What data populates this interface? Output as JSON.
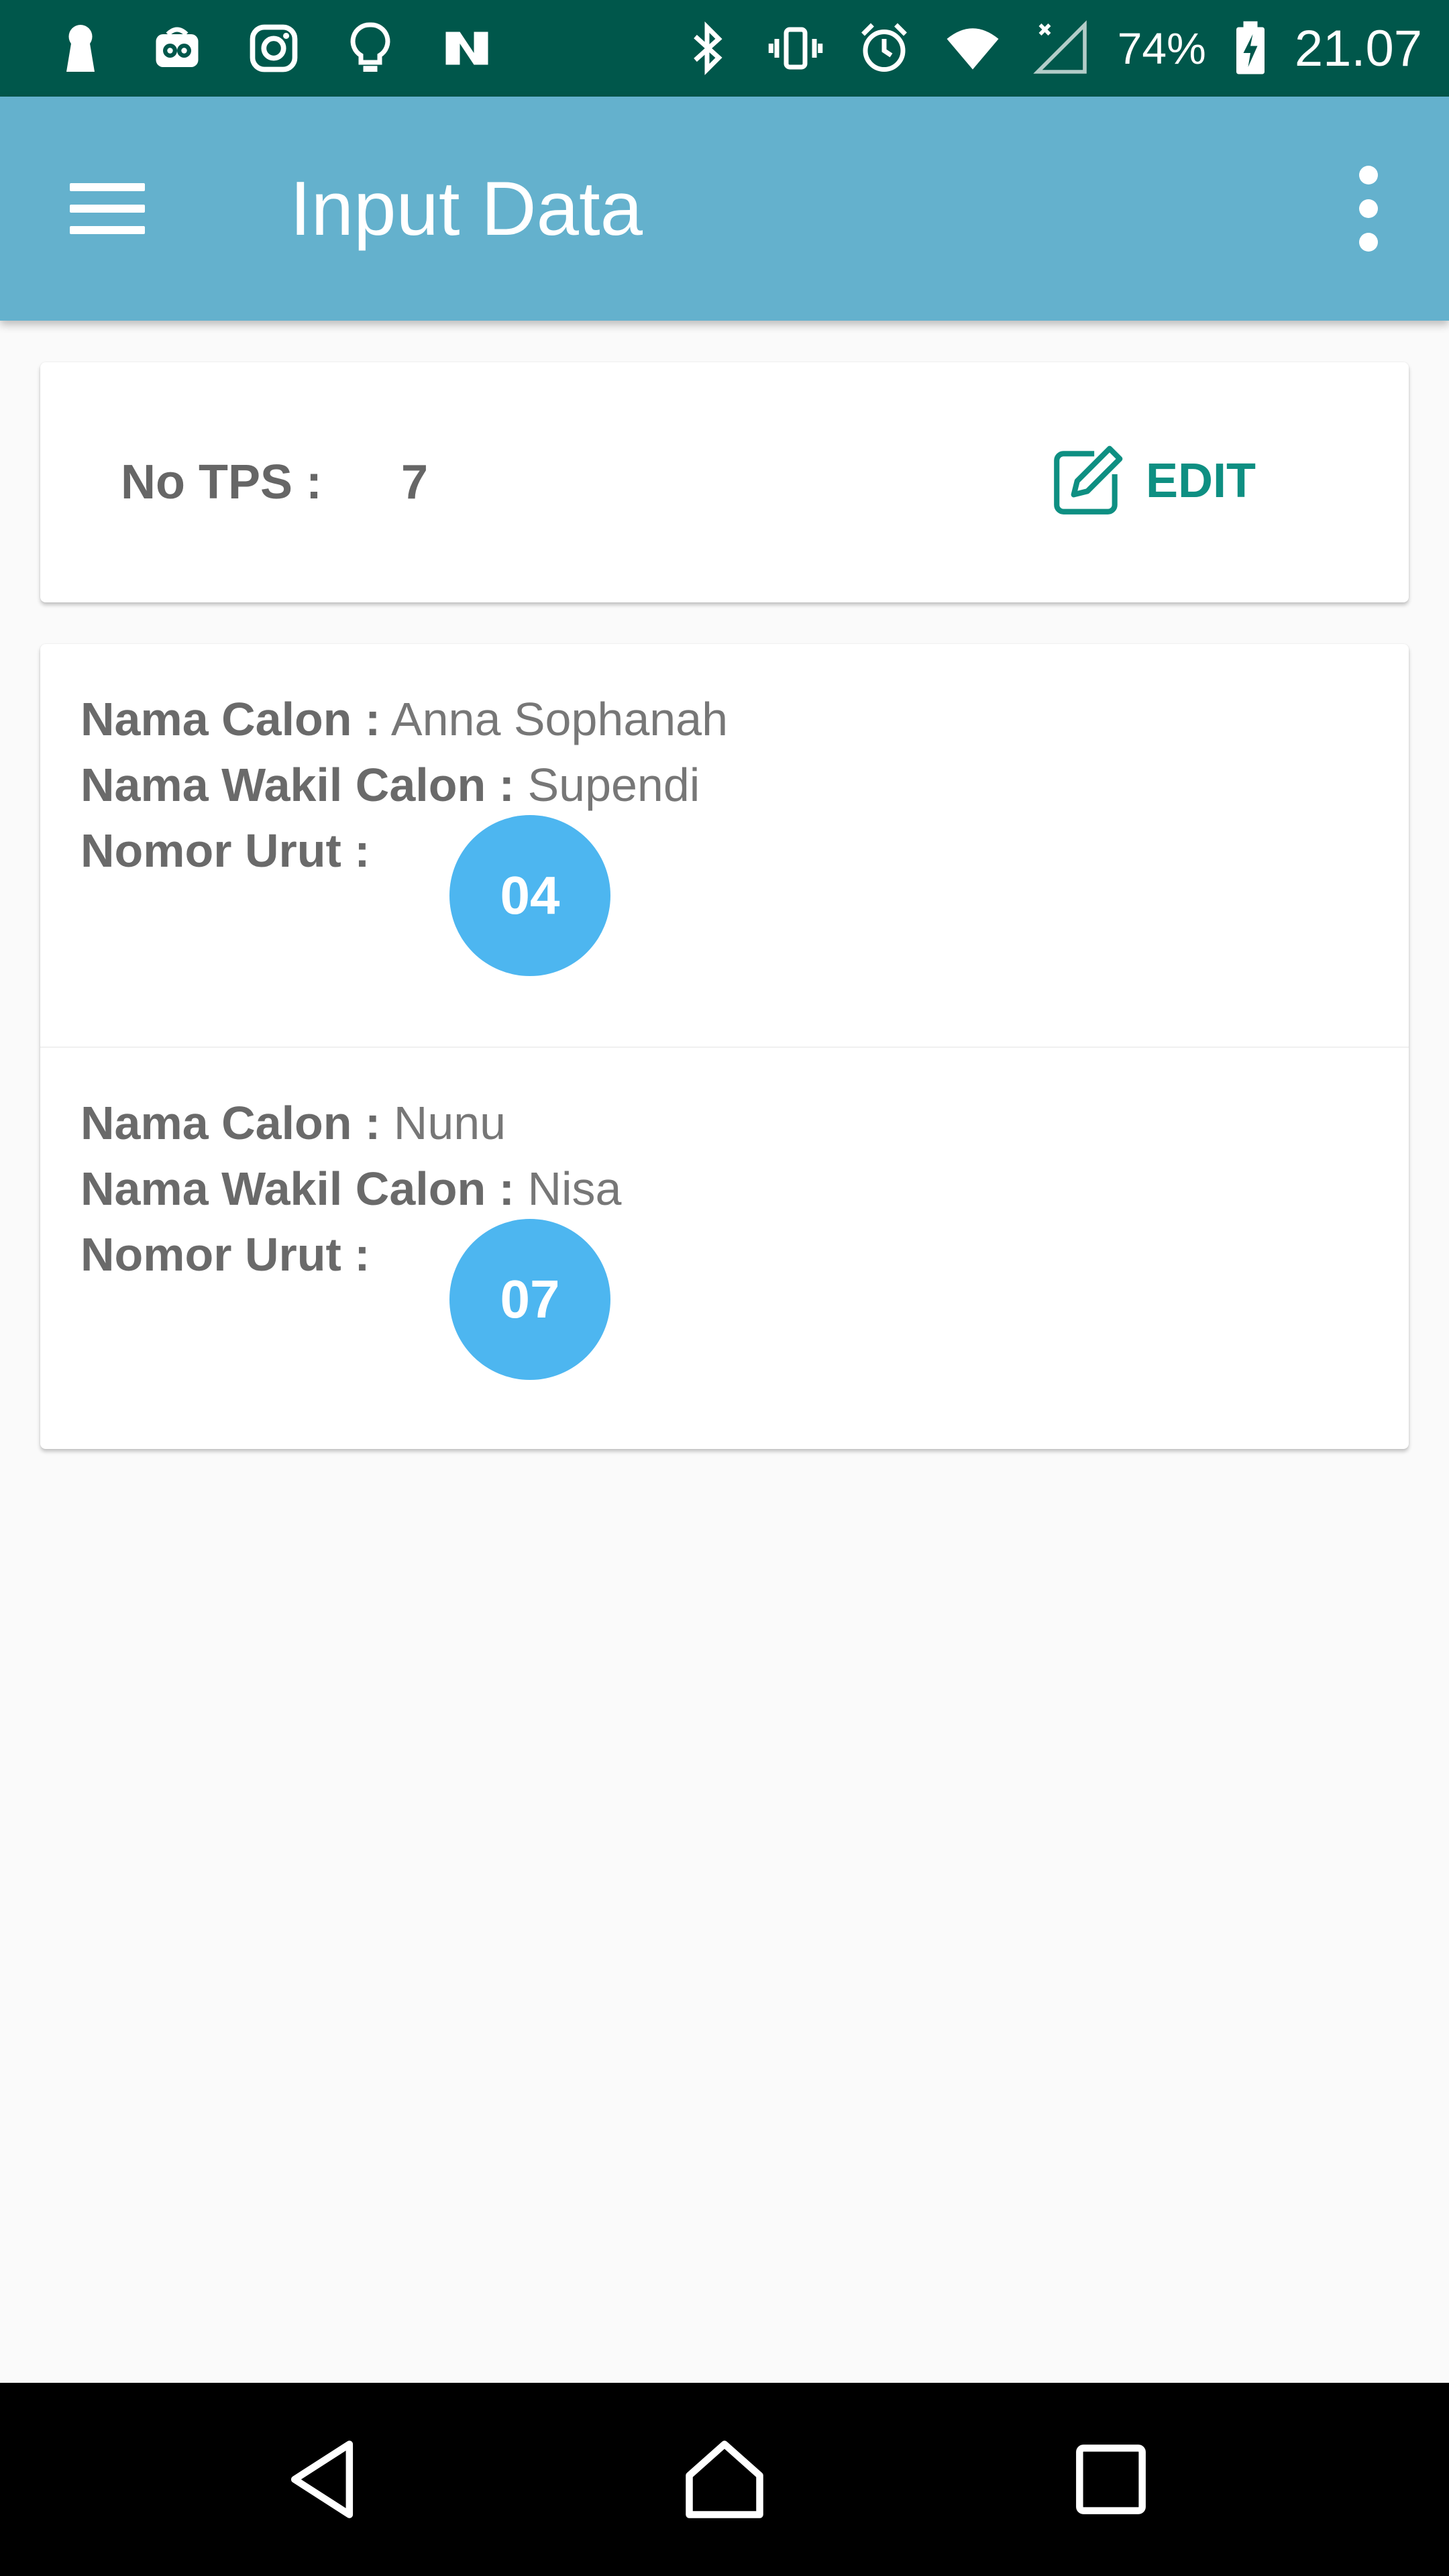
{
  "status_bar": {
    "left_icons": [
      "keyhole-icon",
      "tripadvisor-icon",
      "instagram-icon",
      "lightbulb-icon",
      "n-app-icon"
    ],
    "right_icons": [
      "bluetooth-icon",
      "vibrate-icon",
      "alarm-icon",
      "wifi-icon",
      "signal-icon",
      "battery-icon"
    ],
    "battery": "74%",
    "time": "21.07"
  },
  "app_bar": {
    "title": "Input Data",
    "color": "#64b1cd"
  },
  "tps_card": {
    "label": "No TPS :",
    "value": "7",
    "edit_label": "EDIT",
    "accent": "#0e8f82"
  },
  "candidates": [
    {
      "nama_calon_label": "Nama Calon :",
      "nama_calon": "Anna Sophanah",
      "nama_wakil_label": "Nama Wakil Calon :",
      "nama_wakil": "Supendi",
      "nomor_urut_label": "Nomor Urut :",
      "nomor_urut": "04"
    },
    {
      "nama_calon_label": "Nama Calon :",
      "nama_calon": "Nunu",
      "nama_wakil_label": "Nama Wakil Calon :",
      "nama_wakil": "Nisa",
      "nomor_urut_label": "Nomor Urut :",
      "nomor_urut": "07"
    }
  ],
  "nav_bar": {
    "buttons": [
      "back-icon",
      "home-icon",
      "recents-icon"
    ]
  }
}
